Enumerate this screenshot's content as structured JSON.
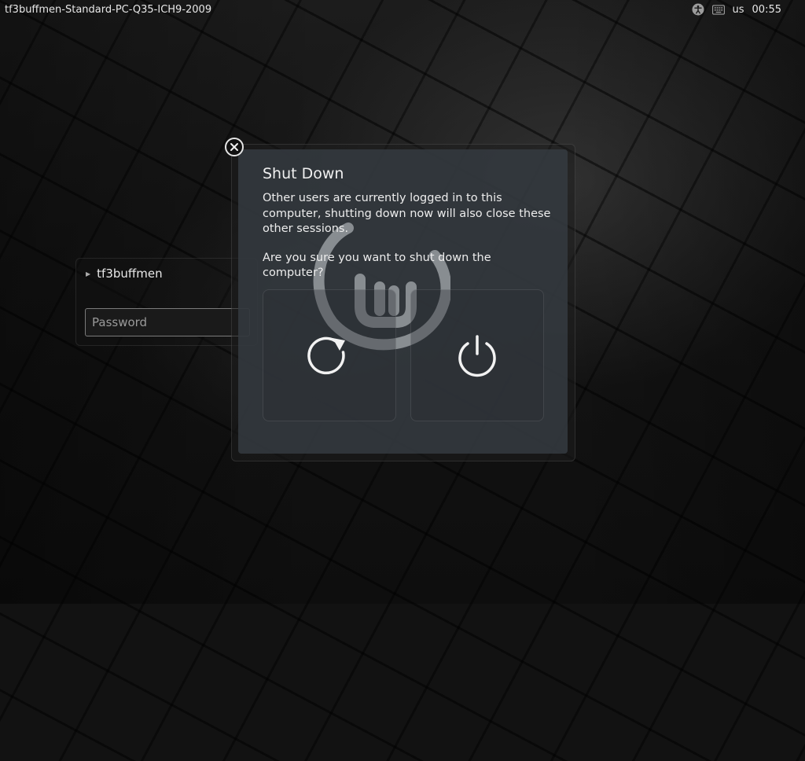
{
  "topbar": {
    "hostname": "tf3buffmen-Standard-PC-Q35-ICH9-2009",
    "keyboard_layout": "us",
    "clock": "00:55",
    "icons": [
      "accessibility-icon",
      "keyboard-icon"
    ]
  },
  "login": {
    "username": "tf3buffmen",
    "password_placeholder": "Password"
  },
  "dialog": {
    "title": "Shut Down",
    "message": "Other users are currently logged in to this computer, shutting down now will also close these other sessions.",
    "question": "Are you sure you want to shut down the computer?",
    "buttons": [
      {
        "name": "restart",
        "icon": "restart-icon"
      },
      {
        "name": "shutdown",
        "icon": "power-icon"
      }
    ]
  }
}
